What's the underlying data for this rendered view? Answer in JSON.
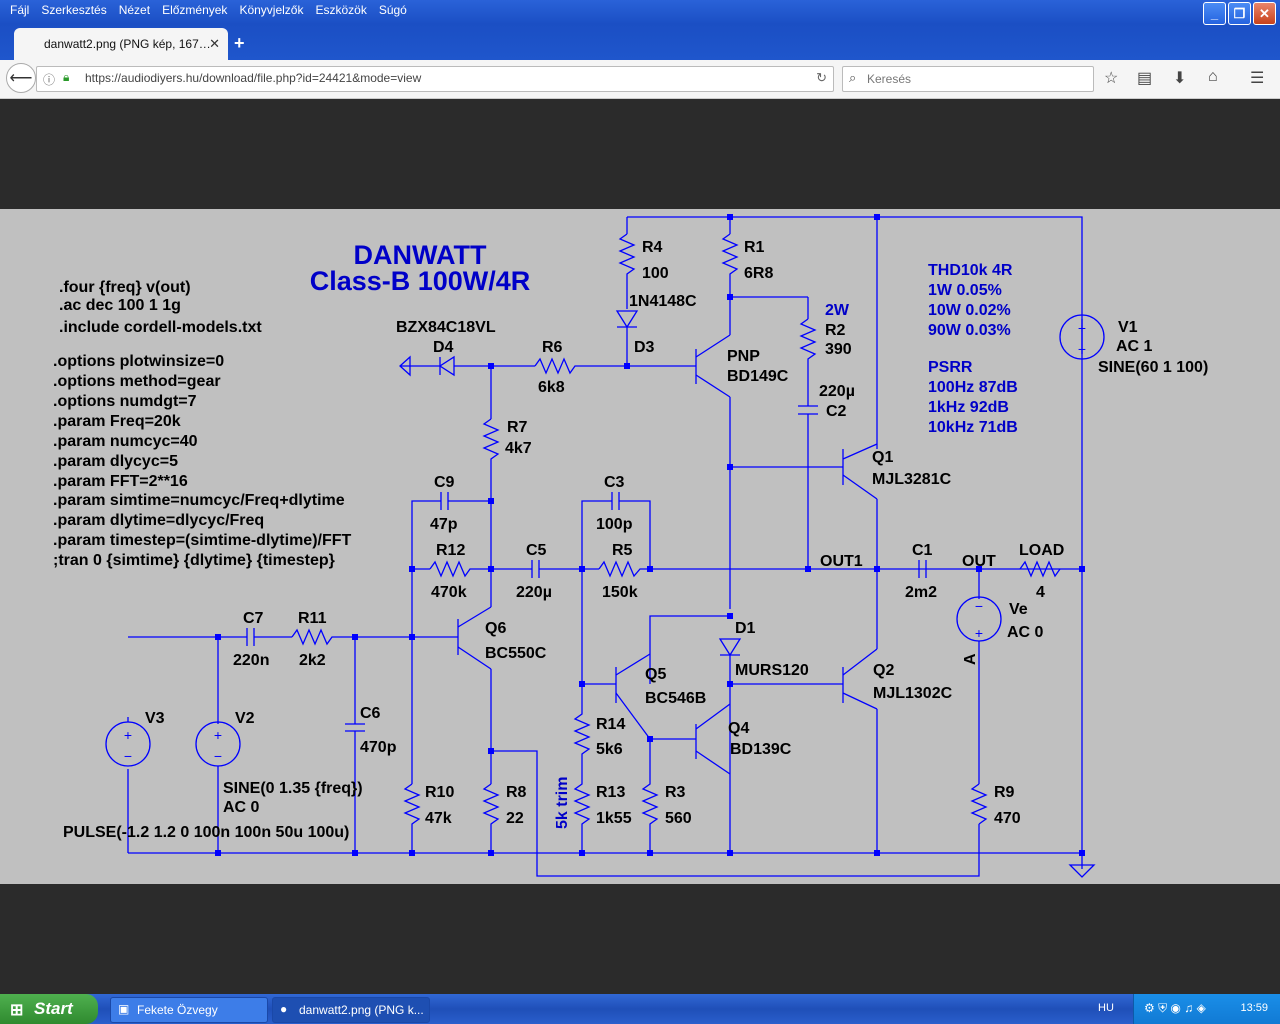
{
  "window": {
    "menu": [
      "Fájl",
      "Szerkesztés",
      "Nézet",
      "Előzmények",
      "Könyvjelzők",
      "Eszközök",
      "Súgó"
    ],
    "tab_title": "danwatt2.png (PNG kép, 167…",
    "url": "https://audiodiyers.hu/download/file.php?id=24421&mode=view",
    "search_placeholder": "Keresés"
  },
  "schematic": {
    "title": "DANWATT",
    "subtitle": "Class-B 100W/4R",
    "directives_a": [
      ".four {freq} v(out)",
      ".ac dec 100 1 1g",
      ".include cordell-models.txt"
    ],
    "directives_b": [
      ".options plotwinsize=0",
      ".options method=gear",
      ".options numdgt=7",
      ".param Freq=20k",
      ".param numcyc=40",
      ".param dlycyc=5",
      ".param FFT=2**16",
      ".param simtime=numcyc/Freq+dlytime",
      ".param dlytime=dlycyc/Freq",
      ".param timestep=(simtime-dlytime)/FFT",
      ";tran 0 {simtime} {dlytime} {timestep}"
    ],
    "thd": [
      "THD10k 4R",
      "1W   0.05%",
      "10W  0.02%",
      "90W  0.03%"
    ],
    "psrr": [
      "PSRR",
      "100Hz  87dB",
      "1kHz   92dB",
      "10kHz  71dB"
    ],
    "components": {
      "R4": [
        "R4",
        "100"
      ],
      "R1": [
        "R1",
        "6R8"
      ],
      "D3n": [
        "1N4148C"
      ],
      "D3": [
        "D3"
      ],
      "R2": [
        "2W",
        "R2",
        "390"
      ],
      "C2": [
        "220µ",
        "C2"
      ],
      "D4": [
        "BZX84C18VL",
        "D4"
      ],
      "R6": [
        "R6",
        "6k8"
      ],
      "Qpnp": [
        "PNP",
        "BD149C"
      ],
      "R7": [
        "R7",
        "4k7"
      ],
      "C9": [
        "C9",
        "47p"
      ],
      "C3": [
        "C3",
        "100p"
      ],
      "R12": [
        "R12",
        "470k"
      ],
      "C5": [
        "C5",
        "220µ"
      ],
      "R5": [
        "R5",
        "150k"
      ],
      "OUT1": "OUT1",
      "C1": [
        "C1",
        "2m2"
      ],
      "OUT": "OUT",
      "LOAD": [
        "LOAD",
        "4"
      ],
      "Q1": [
        "Q1",
        "MJL3281C"
      ],
      "V1": [
        "V1",
        "AC 1",
        "SINE(60 1 100)"
      ],
      "C7": [
        "C7",
        "220n"
      ],
      "R11": [
        "R11",
        "2k2"
      ],
      "Q6": [
        "Q6",
        "BC550C"
      ],
      "D1": [
        "D1",
        "MURS120"
      ],
      "Q5": [
        "Q5",
        "BC546B"
      ],
      "Q2": [
        "Q2",
        "MJL1302C"
      ],
      "Ve": [
        "Ve",
        "AC 0"
      ],
      "A": "A",
      "V3": "V3",
      "V2": "V2",
      "C6": [
        "C6",
        "470p"
      ],
      "Q4": [
        "Q4",
        "BD139C"
      ],
      "R14": [
        "R14",
        "5k6"
      ],
      "trim": "5k trim",
      "R10": [
        "R10",
        "47k"
      ],
      "R8": [
        "R8",
        "22"
      ],
      "R13": [
        "R13",
        "1k55"
      ],
      "R3": [
        "R3",
        "560"
      ],
      "R9": [
        "R9",
        "470"
      ],
      "V2src": [
        "SINE(0 1.35 {freq})",
        "AC 0"
      ],
      "V3src": "PULSE(-1.2 1.2 0 100n 100n 50u 100u)"
    }
  },
  "taskbar": {
    "start": "Start",
    "tasks": [
      "Fekete Özvegy",
      "danwatt2.png (PNG k..."
    ],
    "lang": "HU",
    "clock": "13:59"
  },
  "colors": {
    "schematic_bg": "#c0c0c0",
    "wire": "#0000ff",
    "text": "#000000",
    "title": "#0000c8"
  }
}
